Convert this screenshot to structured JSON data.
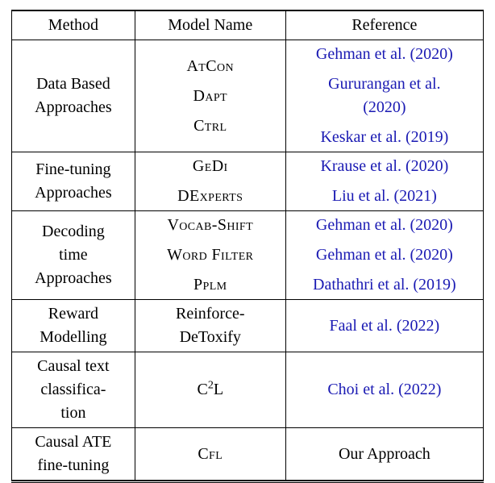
{
  "header": {
    "method": "Method",
    "model": "Model Name",
    "reference": "Reference"
  },
  "rows": [
    {
      "method_lines": [
        "Data Based",
        "Approaches"
      ],
      "models": [
        {
          "smallcaps": true,
          "text": "AtCon"
        },
        {
          "smallcaps": true,
          "text": "Dapt"
        },
        {
          "smallcaps": true,
          "text": "Ctrl"
        }
      ],
      "refs": [
        {
          "link": true,
          "text": "Gehman et al. (2020)"
        },
        {
          "link": true,
          "multiline": [
            "Gururangan et al.",
            "(2020)"
          ]
        },
        {
          "link": true,
          "text": "Keskar et al. (2019)"
        }
      ]
    },
    {
      "method_lines": [
        "Fine-tuning",
        "Approaches"
      ],
      "models": [
        {
          "smallcaps": true,
          "text": "GeDi"
        },
        {
          "smallcaps": true,
          "text": "DExperts"
        }
      ],
      "refs": [
        {
          "link": true,
          "text": "Krause et al. (2020)"
        },
        {
          "link": true,
          "text": "Liu et al. (2021)"
        }
      ]
    },
    {
      "method_lines": [
        "Decoding",
        "time",
        "Approaches"
      ],
      "models": [
        {
          "smallcaps": true,
          "text": "Vocab-Shift"
        },
        {
          "smallcaps": true,
          "text": "Word Filter"
        },
        {
          "smallcaps": true,
          "text": "Pplm"
        }
      ],
      "refs": [
        {
          "link": true,
          "text": "Gehman et al. (2020)"
        },
        {
          "link": true,
          "text": "Gehman et al. (2020)"
        },
        {
          "link": true,
          "text": "Dathathri et al. (2019)"
        }
      ]
    },
    {
      "method_lines": [
        "Reward",
        "Modelling"
      ],
      "models": [
        {
          "smallcaps": false,
          "multiline": [
            "Reinforce-",
            "DeToxify"
          ]
        }
      ],
      "refs": [
        {
          "link": true,
          "text": "Faal et al. (2022)"
        }
      ]
    },
    {
      "method_lines": [
        "Causal text",
        "classifica-",
        "tion"
      ],
      "models": [
        {
          "smallcaps": false,
          "html": "C<sup>2</sup>L"
        }
      ],
      "refs": [
        {
          "link": true,
          "text": "Choi et al. (2022)"
        }
      ]
    },
    {
      "method_lines": [
        "Causal ATE",
        "fine-tuning"
      ],
      "models": [
        {
          "smallcaps": true,
          "text": "Cfl"
        }
      ],
      "refs": [
        {
          "link": false,
          "text": "Our Approach"
        }
      ]
    }
  ]
}
